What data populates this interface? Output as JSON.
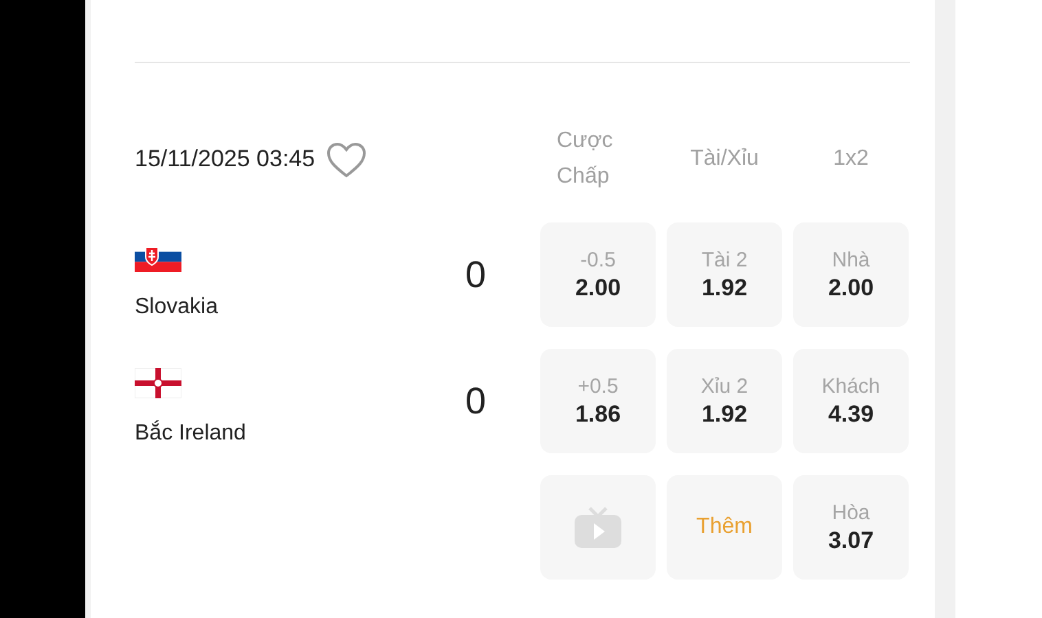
{
  "match": {
    "datetime": "15/11/2025 03:45",
    "favorite": false
  },
  "headers": [
    "Cược Chấp",
    "Tài/Xỉu",
    "1x2"
  ],
  "teams": [
    {
      "kind": "slovakia",
      "name": "Slovakia",
      "score": "0"
    },
    {
      "kind": "northern-ireland",
      "name": "Bắc Ireland",
      "score": "0"
    }
  ],
  "odds": [
    [
      {
        "kind": "odds",
        "label": "-0.5",
        "value": "2.00"
      },
      {
        "kind": "odds",
        "label": "Tài 2",
        "value": "1.92"
      },
      {
        "kind": "odds",
        "label": "Nhà",
        "value": "2.00"
      }
    ],
    [
      {
        "kind": "odds",
        "label": "+0.5",
        "value": "1.86"
      },
      {
        "kind": "odds",
        "label": "Xỉu 2",
        "value": "1.92"
      },
      {
        "kind": "odds",
        "label": "Khách",
        "value": "4.39"
      }
    ],
    [
      {
        "kind": "tv"
      },
      {
        "kind": "more",
        "label": "Thêm"
      },
      {
        "kind": "odds",
        "label": "Hòa",
        "value": "3.07"
      }
    ]
  ]
}
